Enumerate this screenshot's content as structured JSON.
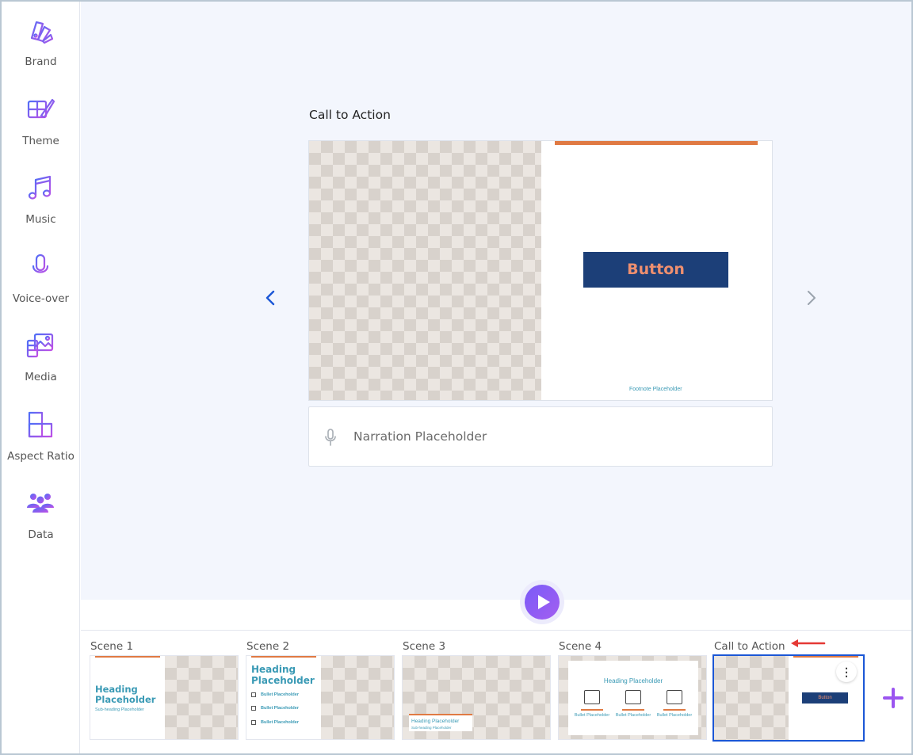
{
  "sidebar": {
    "items": [
      {
        "label": "Brand",
        "icon": "brand-icon"
      },
      {
        "label": "Theme",
        "icon": "theme-icon"
      },
      {
        "label": "Music",
        "icon": "music-icon"
      },
      {
        "label": "Voice-over",
        "icon": "voiceover-icon"
      },
      {
        "label": "Media",
        "icon": "media-icon"
      },
      {
        "label": "Aspect Ratio",
        "icon": "aspect-ratio-icon"
      },
      {
        "label": "Data",
        "icon": "data-icon"
      }
    ]
  },
  "editor": {
    "scene_title": "Call to Action",
    "preview": {
      "button_text": "Button",
      "footnote": "Footnote Placeholder"
    },
    "narration_placeholder": "Narration Placeholder"
  },
  "timeline": {
    "scenes": [
      {
        "label": "Scene 1",
        "heading": "Heading Placeholder",
        "subheading": "Sub-heading Placeholder"
      },
      {
        "label": "Scene 2",
        "heading": "Heading Placeholder",
        "bullets": [
          "Bullet Placeholder",
          "Bullet Placeholder",
          "Bullet Placeholder"
        ]
      },
      {
        "label": "Scene 3",
        "heading": "Heading Placeholder",
        "subheading": "Sub-heading Placeholder"
      },
      {
        "label": "Scene 4",
        "heading": "Heading Placeholder",
        "bullets": [
          "Bullet Placeholder",
          "Bullet Placeholder",
          "Bullet Placeholder"
        ]
      },
      {
        "label": "Call to Action",
        "button_text": "Button",
        "selected": true
      }
    ]
  },
  "colors": {
    "accent_purple": "#8b5cf6",
    "navy": "#1c3f78",
    "orange": "#e07a43",
    "teal": "#3a9ab5",
    "selected_border": "#1b57d6"
  }
}
